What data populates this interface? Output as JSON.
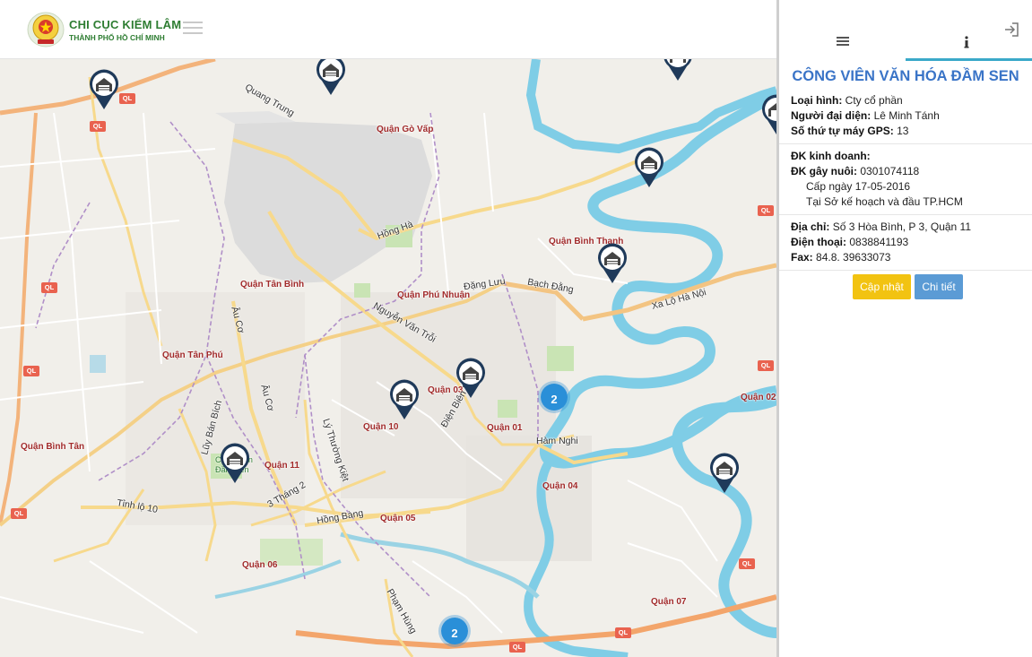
{
  "header": {
    "logo_title": "CHI CỤC KIỂM LÂM",
    "logo_subtitle": "THÀNH PHỐ HỒ CHÍ MINH",
    "menu_icon": "hamburger-icon"
  },
  "map": {
    "district_labels": [
      "Quận Gò Vấp",
      "Quận Tân Bình",
      "Quận Phú Nhuận",
      "Quận Bình Thạnh",
      "Quận Tân Phú",
      "Quận 03",
      "Quận 10",
      "Quận 01",
      "Quận Bình Tân",
      "Quận 11",
      "Quận 04",
      "Quận 05",
      "Quận 06",
      "Quận 02",
      "Quận 07",
      "Công Viên Đầm Sen"
    ],
    "road_labels": [
      "Quang Trung",
      "Hồng Hà",
      "Đặng Lưu",
      "Bạch Đằng",
      "Nguyễn Văn Trỗi",
      "Xa Lộ Hà Nội",
      "Âu Cơ",
      "Âu Cơ",
      "Lũy Bán Bích",
      "Lý Thường Kiệt",
      "Điện Biên Phủ",
      "Hàm Nghi",
      "3 Tháng 2",
      "Hồng Bàng",
      "Tỉnh lộ 10",
      "Phạm Hùng"
    ],
    "highway_shield": "QL",
    "marker_icon": "warehouse-marker-icon",
    "clusters": [
      "2",
      "2"
    ]
  },
  "panel": {
    "tab_list_icon": "list-icon",
    "tab_info_icon": "info-icon",
    "logout_icon": "logout-icon",
    "title": "CÔNG VIÊN VĂN HÓA ĐẦM SEN",
    "type_label": "Loại hình:",
    "type_value": "Cty cổ phần",
    "rep_label": "Người đại diện:",
    "rep_value": "Lê Minh Tánh",
    "gps_label": "Số thứ tự máy GPS:",
    "gps_value": "13",
    "business_label": "ĐK kinh doanh:",
    "breeding_label": "ĐK gây nuôi:",
    "breeding_value": "0301074118",
    "issued_date": "Cấp ngày 17-05-2016",
    "issued_at": "Tại Sở kế hoạch và đầu TP.HCM",
    "address_label": "Địa chỉ:",
    "address_value": "Số 3 Hòa Bình, P 3, Quận 11",
    "phone_label": "Điện thoại:",
    "phone_value": "0838841193",
    "fax_label": "Fax:",
    "fax_value": "84.8. 39633073",
    "update_button": "Cập nhật",
    "detail_button": "Chi tiết"
  }
}
